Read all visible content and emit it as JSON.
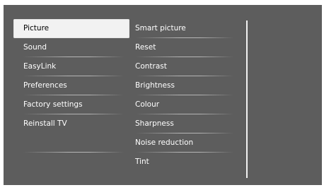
{
  "menu": {
    "categories": [
      {
        "label": "Picture",
        "selected": true
      },
      {
        "label": "Sound",
        "selected": false
      },
      {
        "label": "EasyLink",
        "selected": false
      },
      {
        "label": "Preferences",
        "selected": false
      },
      {
        "label": "Factory settings",
        "selected": false
      },
      {
        "label": "Reinstall TV",
        "selected": false
      }
    ],
    "picture_options": [
      {
        "label": "Smart picture"
      },
      {
        "label": "Reset"
      },
      {
        "label": "Contrast"
      },
      {
        "label": "Brightness"
      },
      {
        "label": "Colour"
      },
      {
        "label": "Sharpness"
      },
      {
        "label": "Noise reduction"
      },
      {
        "label": "Tint"
      }
    ]
  },
  "colors": {
    "background": "#5d5d5d",
    "highlight": "#f2f2f2",
    "text": "#ffffff",
    "selected_text": "#000000"
  }
}
